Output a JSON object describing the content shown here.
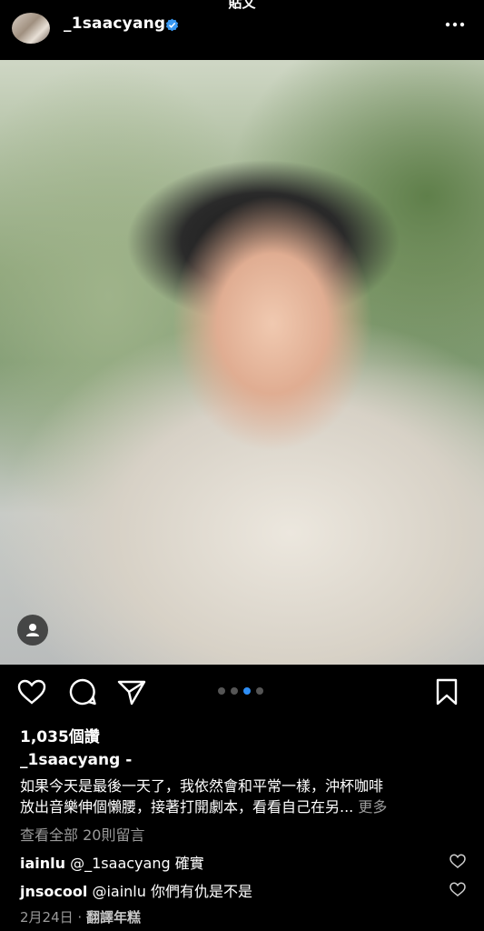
{
  "status": {
    "title": "貼文"
  },
  "post": {
    "username": "_1saacyang",
    "verified": true,
    "likes": "1,035個讚",
    "caption_user": "_1saacyang -",
    "caption_lines": [
      "如果今天是最後一天了，我依然會和平常一樣，沖杯咖啡",
      "放出音樂伸個懶腰，接著打開劇本，看看自己在另..."
    ],
    "more_label": "更多",
    "view_all_comments": "查看全部 20則留言",
    "comments": [
      {
        "user": "iainlu",
        "text": "@_1saacyang 確實"
      },
      {
        "user": "jnsocool",
        "text": "@iainlu 你們有仇是不是"
      }
    ],
    "date": "2月24日 ·",
    "translate": "翻譯年糕",
    "carousel": {
      "count": 4,
      "active_index": 2
    }
  },
  "colors": {
    "accent": "#2e8ef5",
    "background": "#000000",
    "muted": "#9a9a9a"
  },
  "icons": [
    "more-options-icon",
    "verified-badge-icon",
    "user-tag-icon",
    "heart-icon",
    "comment-icon",
    "share-icon",
    "bookmark-icon"
  ]
}
